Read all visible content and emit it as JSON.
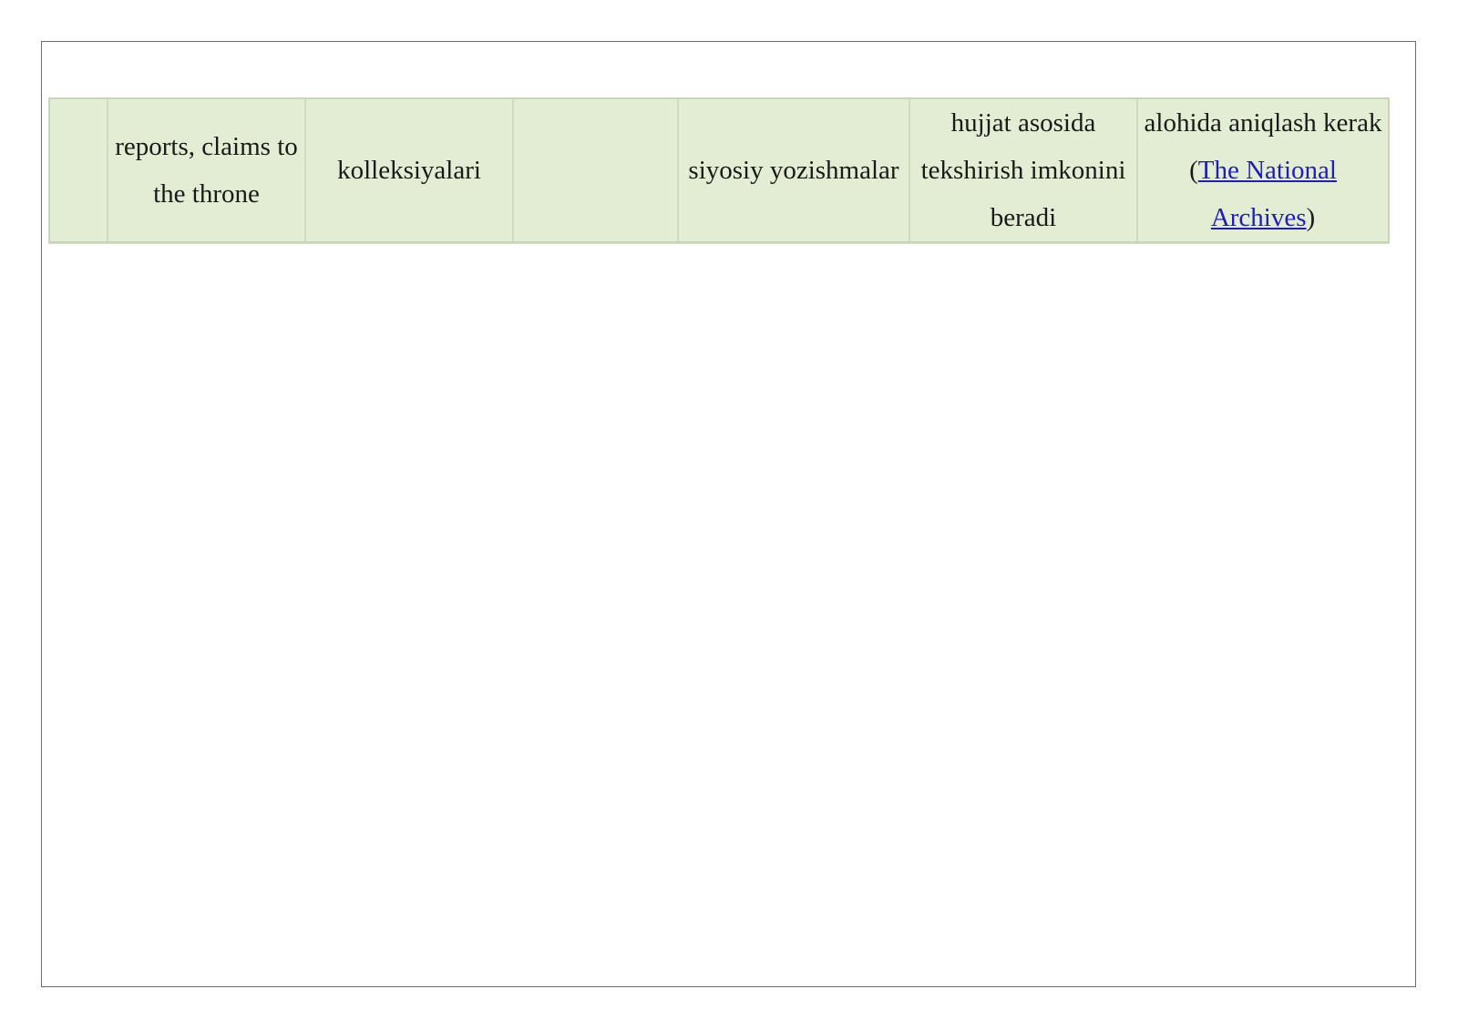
{
  "table": {
    "row": {
      "cell_1": "",
      "cell_2": "reports, claims to the throne",
      "cell_3": "kolleksiyalari",
      "cell_4": "",
      "cell_5": "siyosiy yozishmalar",
      "cell_6": "hujjat asosida tekshirish imkonini beradi",
      "cell_7": {
        "text_before": "alohida aniqlash kerak (",
        "link_text": "The National Archives",
        "text_after": ")"
      }
    }
  },
  "colors": {
    "cell_background": "#e3edd4",
    "cell_border": "#c6d6b2",
    "link": "#1f1fb8"
  }
}
